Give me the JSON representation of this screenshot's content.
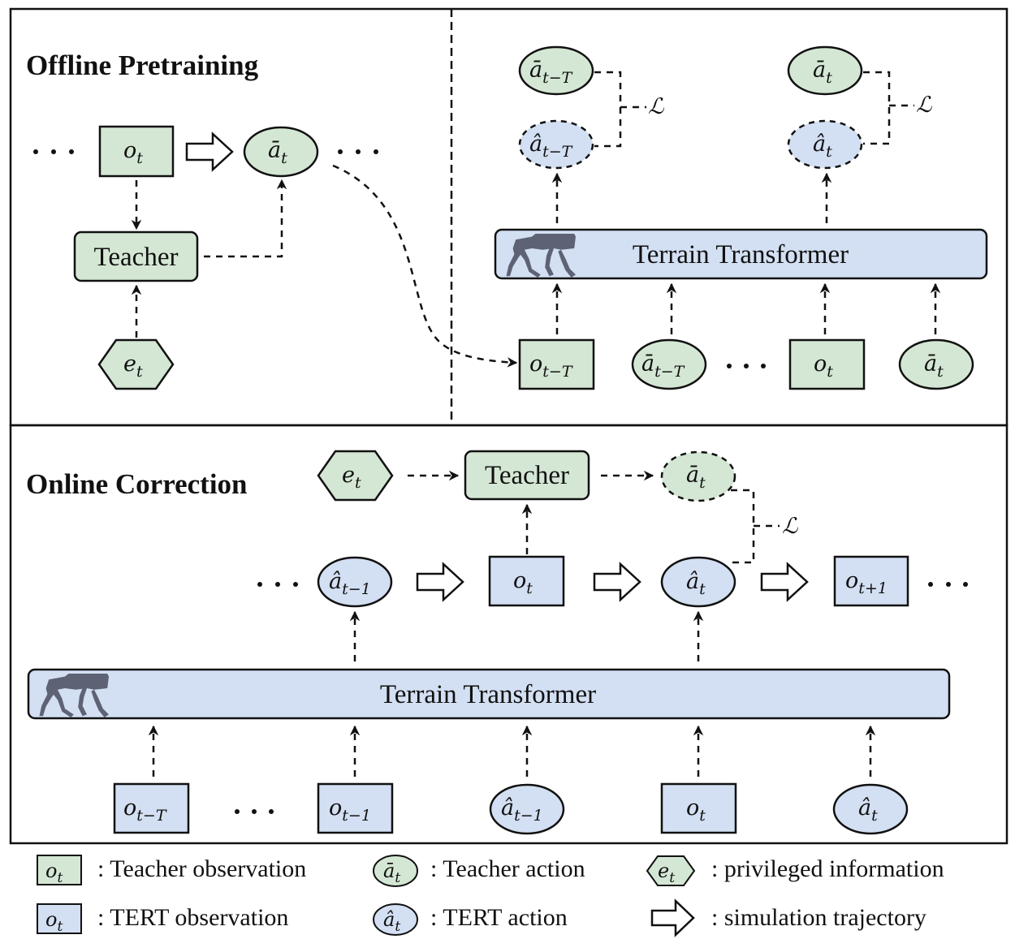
{
  "figure": {
    "sections": {
      "offline": {
        "title": "Offline Pretraining"
      },
      "online": {
        "title": "Online Correction"
      }
    },
    "colors": {
      "teacher_fill": "#d4e7d4",
      "tert_fill": "#d3dff2",
      "outline": "#111111",
      "robot": "#5e6275"
    },
    "offline_left": {
      "obs": {
        "base": "o",
        "sub": "t"
      },
      "action": {
        "base": "ā",
        "sub": "t"
      },
      "teacher": "Teacher",
      "privileged": {
        "base": "e",
        "sub": "t"
      },
      "ellipsis": "···"
    },
    "offline_right": {
      "targets": [
        {
          "base": "ā",
          "sub": "t−T"
        },
        {
          "base": "ā",
          "sub": "t"
        }
      ],
      "predictions": [
        {
          "base": "â",
          "sub": "t−T"
        },
        {
          "base": "â",
          "sub": "t"
        }
      ],
      "loss": "ℒ",
      "transformer": "Terrain Transformer",
      "inputs": [
        {
          "kind": "obs",
          "base": "o",
          "sub": "t−T"
        },
        {
          "kind": "action",
          "base": "ā",
          "sub": "t−T"
        },
        {
          "kind": "obs",
          "base": "o",
          "sub": "t"
        },
        {
          "kind": "action",
          "base": "ā",
          "sub": "t"
        }
      ],
      "ellipsis": "···"
    },
    "online": {
      "privileged": {
        "base": "e",
        "sub": "t"
      },
      "teacher": "Teacher",
      "teacher_action": {
        "base": "ā",
        "sub": "t"
      },
      "loss": "ℒ",
      "trajectory": [
        {
          "kind": "action",
          "base": "â",
          "sub": "t−1"
        },
        {
          "kind": "obs",
          "base": "o",
          "sub": "t"
        },
        {
          "kind": "action",
          "base": "â",
          "sub": "t"
        },
        {
          "kind": "obs",
          "base": "o",
          "sub": "t+1"
        }
      ],
      "transformer": "Terrain Transformer",
      "inputs": [
        {
          "kind": "obs",
          "base": "o",
          "sub": "t−T"
        },
        {
          "kind": "obs",
          "base": "o",
          "sub": "t−1"
        },
        {
          "kind": "action",
          "base": "â",
          "sub": "t−1"
        },
        {
          "kind": "obs",
          "base": "o",
          "sub": "t"
        },
        {
          "kind": "action",
          "base": "â",
          "sub": "t"
        }
      ],
      "ellipsis": "···"
    },
    "legend": [
      {
        "symbol": "green-rect",
        "base": "o",
        "sub": "t",
        "text": ": Teacher observation"
      },
      {
        "symbol": "green-ellipse",
        "base": "ā",
        "sub": "t",
        "text": ": Teacher action"
      },
      {
        "symbol": "green-hexagon",
        "base": "e",
        "sub": "t",
        "text": ": privileged information"
      },
      {
        "symbol": "blue-rect",
        "base": "o",
        "sub": "t",
        "text": ": TERT observation"
      },
      {
        "symbol": "blue-ellipse",
        "base": "â",
        "sub": "t",
        "text": ": TERT action"
      },
      {
        "symbol": "hollow-arrow",
        "base": "",
        "sub": "",
        "text": ": simulation trajectory"
      }
    ]
  }
}
